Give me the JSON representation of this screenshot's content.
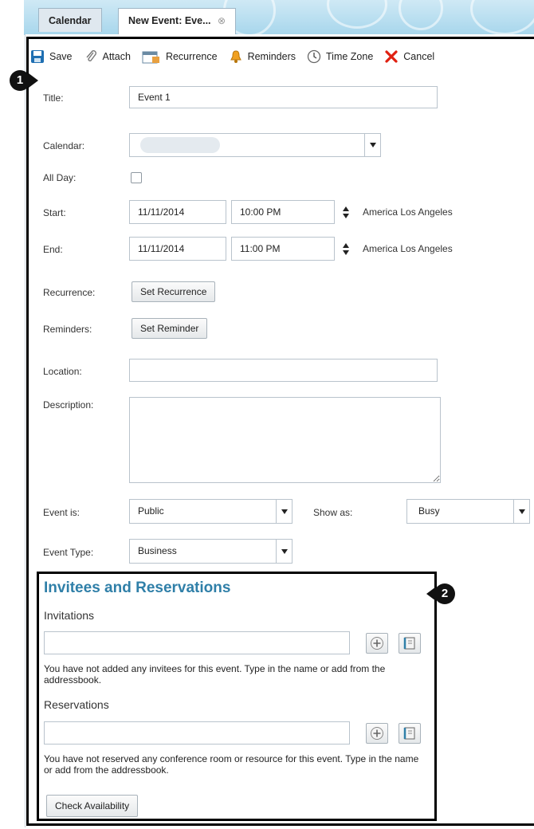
{
  "tabs": [
    {
      "label": "Calendar",
      "active": false
    },
    {
      "label": "New Event: Eve...",
      "active": true
    }
  ],
  "toolbar": {
    "save": "Save",
    "attach": "Attach",
    "recurrence": "Recurrence",
    "reminders": "Reminders",
    "time_zone": "Time Zone",
    "cancel": "Cancel"
  },
  "callouts": [
    "1",
    "2"
  ],
  "form": {
    "title_label": "Title:",
    "title_value": "Event 1",
    "calendar_label": "Calendar:",
    "all_day_label": "All Day:",
    "all_day_checked": false,
    "start_label": "Start:",
    "start_date": "11/11/2014",
    "start_time": "10:00 PM",
    "start_tz": "America Los Angeles",
    "end_label": "End:",
    "end_date": "11/11/2014",
    "end_time": "11:00 PM",
    "end_tz": "America Los Angeles",
    "recurrence_label": "Recurrence:",
    "set_recurrence": "Set Recurrence",
    "reminders_label": "Reminders:",
    "set_reminder": "Set Reminder",
    "location_label": "Location:",
    "location_value": "",
    "description_label": "Description:",
    "description_value": "",
    "event_is_label": "Event is:",
    "event_is_value": "Public",
    "show_as_label": "Show as:",
    "show_as_value": "Busy",
    "event_type_label": "Event Type:",
    "event_type_value": "Business"
  },
  "invitees": {
    "heading": "Invitees and Reservations",
    "invitations_label": "Invitations",
    "invitations_value": "",
    "invitations_help": "You have not added any invitees for this event. Type in the name or add from the addressbook.",
    "reservations_label": "Reservations",
    "reservations_value": "",
    "reservations_help": "You have not reserved any conference room or resource for this event. Type in the name or add from the addressbook.",
    "check_availability": "Check Availability"
  },
  "colors": {
    "heading": "#2f7fa8",
    "cancel_icon": "#e02010",
    "save_icon": "#1f6fb2"
  }
}
